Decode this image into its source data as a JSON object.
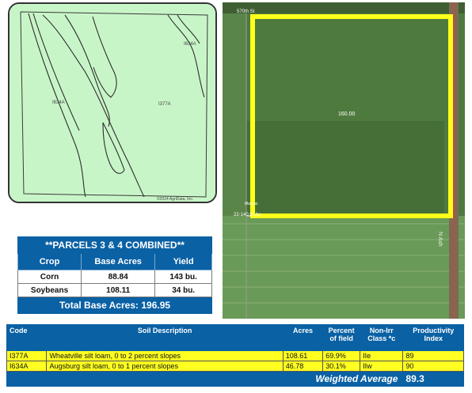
{
  "soil_map": {
    "labels": [
      "I634A",
      "I634A",
      "I377A"
    ],
    "copyright": "©2024 AgriData, Inc.",
    "fill_color": "#c8f5c8"
  },
  "aerial": {
    "field_label": "160.00",
    "road_top": "570th St",
    "road_bottom": "22-140 th Av",
    "road_right": "N Ash",
    "small_label": "Marcus",
    "outline_color": "#ffff1a"
  },
  "parcels": {
    "banner": "**PARCELS 3 & 4 COMBINED**",
    "headers": [
      "Crop",
      "Base Acres",
      "Yield"
    ],
    "rows": [
      [
        "Corn",
        "88.84",
        "143 bu."
      ],
      [
        "Soybeans",
        "108.11",
        "34 bu."
      ]
    ],
    "total_label": "Total Base Acres:",
    "total_value": "196.95"
  },
  "soils": {
    "headers": {
      "code": "Code",
      "desc": "Soil Description",
      "acres": "Acres",
      "pct": "Percent of field",
      "class": "Non-Irr Class *c",
      "pi": "Productivity Index"
    },
    "rows": [
      {
        "code": "I377A",
        "desc": "Wheatville silt loam, 0 to 2 percent slopes",
        "acres": "108.61",
        "pct": "69.9%",
        "class": "IIe",
        "pi": "89"
      },
      {
        "code": "I634A",
        "desc": "Augsburg silt loam, 0 to 1 percent slopes",
        "acres": "46.78",
        "pct": "30.1%",
        "class": "IIw",
        "pi": "90"
      }
    ],
    "avg_label": "Weighted Average",
    "avg_value": "89.3"
  }
}
